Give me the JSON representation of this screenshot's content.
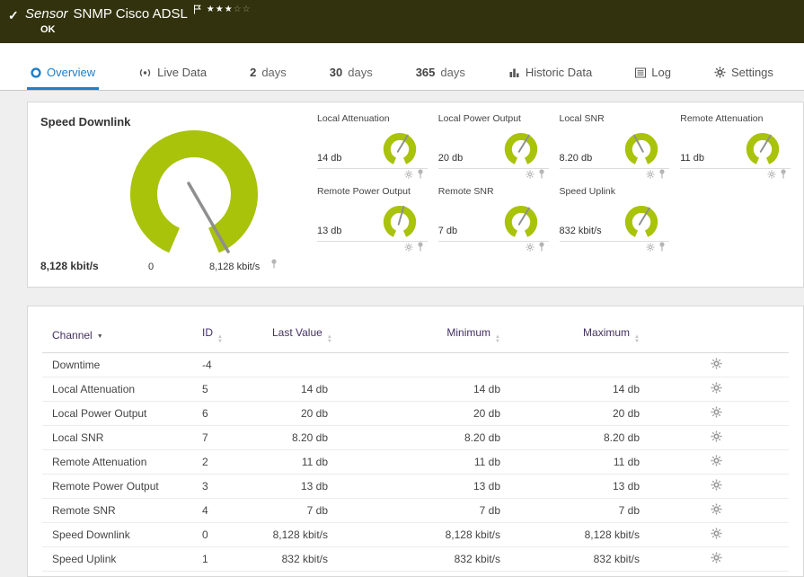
{
  "colors": {
    "header_bg": "#32320e",
    "gauge_green": "#a9c30b",
    "active_tab_blue": "#1e7ec8",
    "table_header_text": "#43315e"
  },
  "header": {
    "check": "✓",
    "kind": "Sensor",
    "title": "SNMP Cisco ADSL",
    "stars_filled": "★★★",
    "stars_empty": "☆☆",
    "status": "OK"
  },
  "tabs": [
    {
      "label": "Overview"
    },
    {
      "label": "Live Data"
    },
    {
      "num": "2",
      "unit": "days"
    },
    {
      "num": "30",
      "unit": "days"
    },
    {
      "num": "365",
      "unit": "days"
    },
    {
      "label": "Historic Data"
    },
    {
      "label": "Log"
    },
    {
      "label": "Settings"
    }
  ],
  "gauges": {
    "primary": {
      "label": "Speed Downlink",
      "value": "8,128 kbit/s",
      "scale_min": "0",
      "scale_max": "8,128 kbit/s"
    },
    "small": [
      {
        "label": "Local Attenuation",
        "value": "14 db"
      },
      {
        "label": "Local Power Output",
        "value": "20 db"
      },
      {
        "label": "Local SNR",
        "value": "8.20 db"
      },
      {
        "label": "Remote Attenuation",
        "value": "11 db"
      },
      {
        "label": "Remote Power Output",
        "value": "13 db"
      },
      {
        "label": "Remote SNR",
        "value": "7 db"
      },
      {
        "label": "Speed Uplink",
        "value": "832 kbit/s"
      }
    ]
  },
  "table": {
    "headers": {
      "channel": "Channel",
      "id": "ID",
      "last": "Last Value",
      "min": "Minimum",
      "max": "Maximum"
    },
    "rows": [
      {
        "channel": "Downtime",
        "id": "-4",
        "last": "",
        "min": "",
        "max": ""
      },
      {
        "channel": "Local Attenuation",
        "id": "5",
        "last": "14 db",
        "min": "14 db",
        "max": "14 db"
      },
      {
        "channel": "Local Power Output",
        "id": "6",
        "last": "20 db",
        "min": "20 db",
        "max": "20 db"
      },
      {
        "channel": "Local SNR",
        "id": "7",
        "last": "8.20 db",
        "min": "8.20 db",
        "max": "8.20 db"
      },
      {
        "channel": "Remote Attenuation",
        "id": "2",
        "last": "11 db",
        "min": "11 db",
        "max": "11 db"
      },
      {
        "channel": "Remote Power Output",
        "id": "3",
        "last": "13 db",
        "min": "13 db",
        "max": "13 db"
      },
      {
        "channel": "Remote SNR",
        "id": "4",
        "last": "7 db",
        "min": "7 db",
        "max": "7 db"
      },
      {
        "channel": "Speed Downlink",
        "id": "0",
        "last": "8,128 kbit/s",
        "min": "8,128 kbit/s",
        "max": "8,128 kbit/s"
      },
      {
        "channel": "Speed Uplink",
        "id": "1",
        "last": "832 kbit/s",
        "min": "832 kbit/s",
        "max": "832 kbit/s"
      }
    ]
  }
}
